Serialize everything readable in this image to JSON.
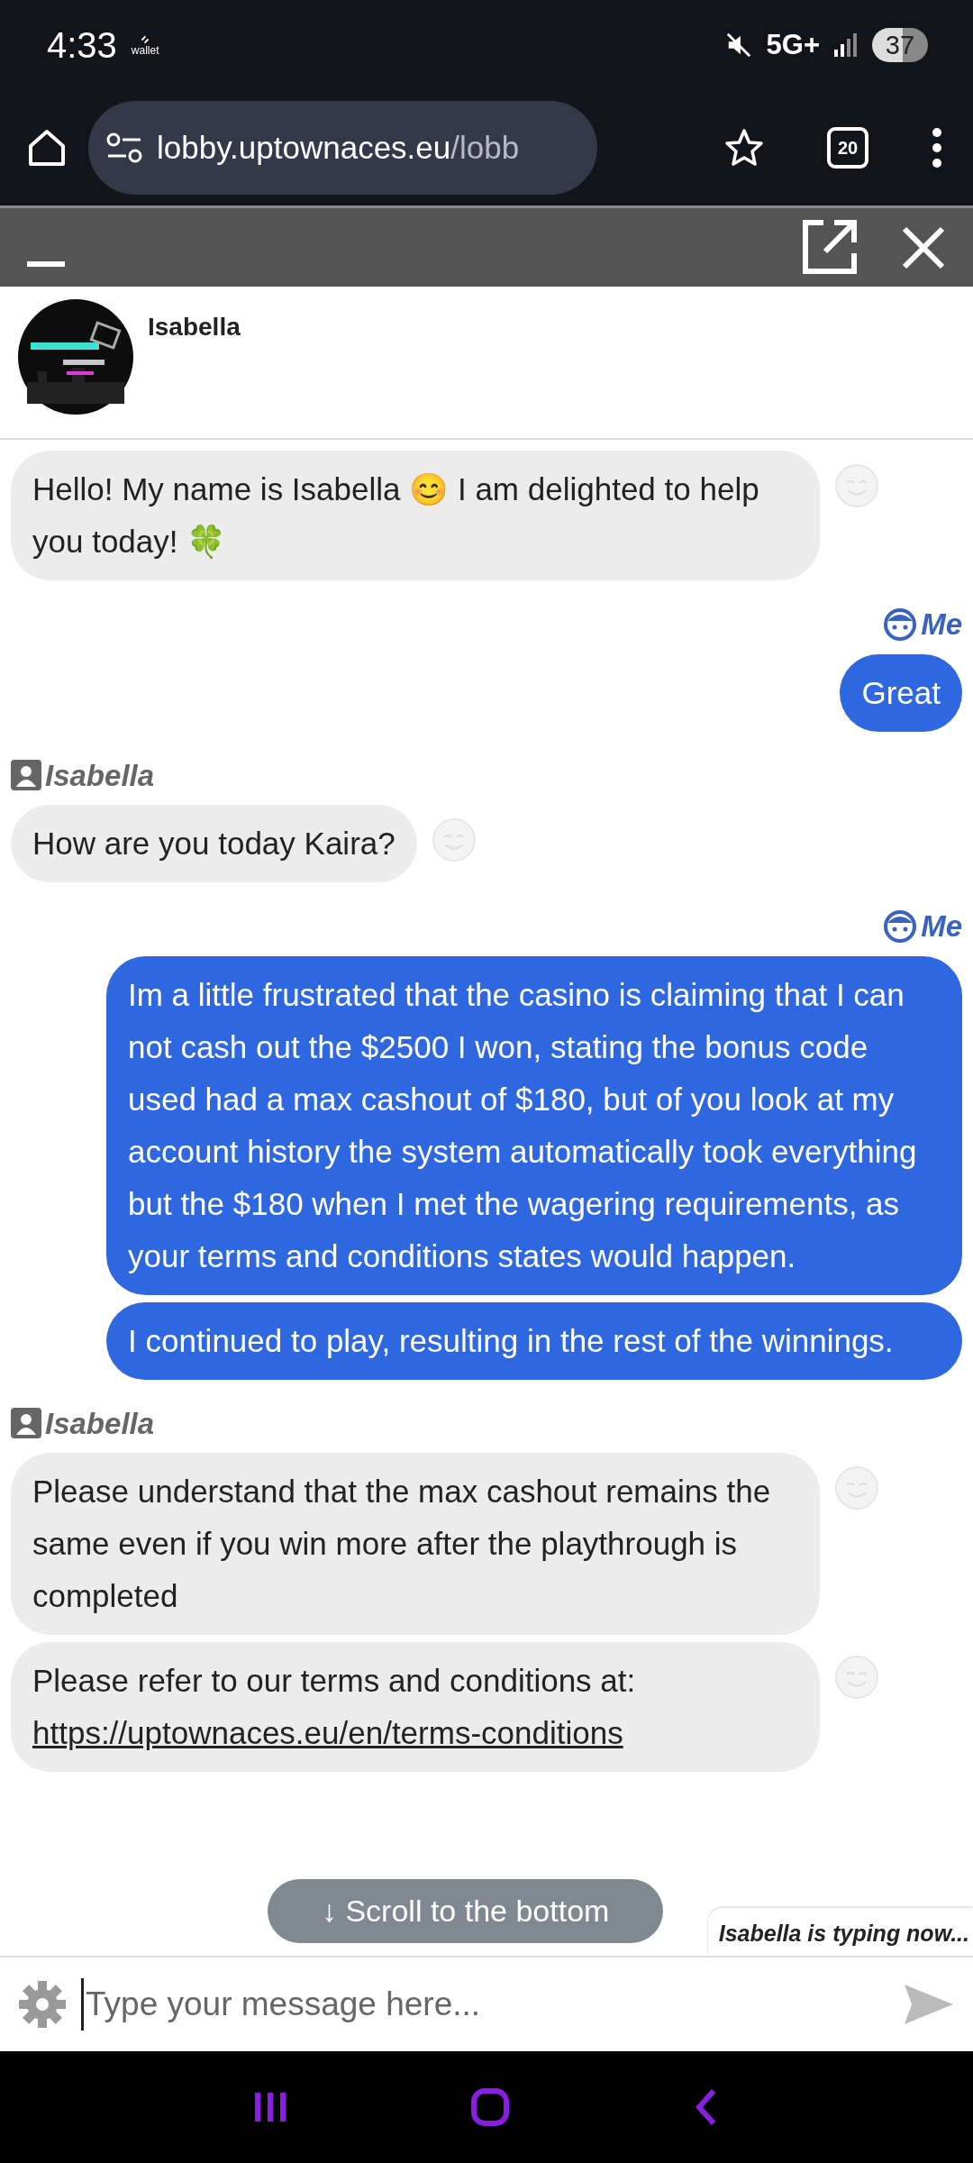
{
  "status_bar": {
    "time": "4:33",
    "wallet_label": "wallet",
    "network": "5G+",
    "battery": "37"
  },
  "browser": {
    "url_host": "lobby.uptownaces.eu",
    "url_path": "/lobb",
    "tab_count": "20"
  },
  "chat_header": {
    "agent_name": "Isabella"
  },
  "messages": [
    {
      "kind": "agent",
      "text": "Hello! My name is Isabella 😊 I am delighted to help you today! 🍀"
    },
    {
      "kind": "user",
      "sender": "Me",
      "text": "Great"
    },
    {
      "kind": "agent",
      "sender": "Isabella",
      "text": "How are you today Kaira?"
    },
    {
      "kind": "user",
      "sender": "Me",
      "text": "Im a little frustrated that the casino is claiming that I can not cash out the $2500 I won, stating the bonus code used had a max cashout of $180, but of you look at my account history the system automatically took everything but the $180 when I met the wagering requirements, as your terms and conditions states would happen."
    },
    {
      "kind": "user",
      "text": "I continued to play, resulting in the rest of the winnings."
    },
    {
      "kind": "agent",
      "sender": "Isabella",
      "text": "Please understand that the max cashout remains the same even if you win more after the playthrough is completed"
    },
    {
      "kind": "agent",
      "text": "Please refer to our terms and conditions at:",
      "link": "https://uptownaces.eu/en/terms-conditions"
    }
  ],
  "scroll_button": "↓ Scroll to the bottom",
  "typing_indicator": "Isabella is typing now...",
  "composer": {
    "placeholder": "Type your message here..."
  }
}
